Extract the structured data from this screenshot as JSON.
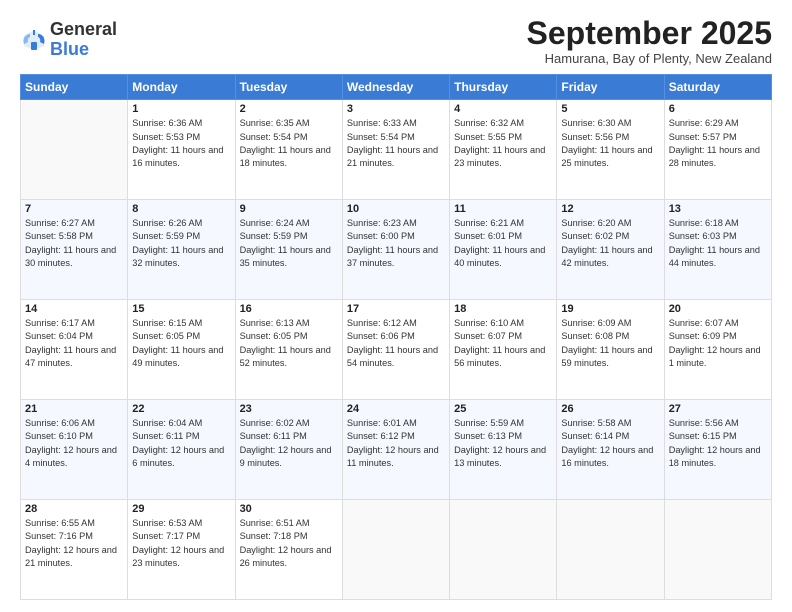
{
  "header": {
    "logo": {
      "general": "General",
      "blue": "Blue"
    },
    "title": "September 2025",
    "location": "Hamurana, Bay of Plenty, New Zealand"
  },
  "days": [
    "Sunday",
    "Monday",
    "Tuesday",
    "Wednesday",
    "Thursday",
    "Friday",
    "Saturday"
  ],
  "weeks": [
    [
      null,
      {
        "n": "1",
        "sr": "6:36 AM",
        "ss": "5:53 PM",
        "dl": "11 hours and 16 minutes."
      },
      {
        "n": "2",
        "sr": "6:35 AM",
        "ss": "5:54 PM",
        "dl": "11 hours and 18 minutes."
      },
      {
        "n": "3",
        "sr": "6:33 AM",
        "ss": "5:54 PM",
        "dl": "11 hours and 21 minutes."
      },
      {
        "n": "4",
        "sr": "6:32 AM",
        "ss": "5:55 PM",
        "dl": "11 hours and 23 minutes."
      },
      {
        "n": "5",
        "sr": "6:30 AM",
        "ss": "5:56 PM",
        "dl": "11 hours and 25 minutes."
      },
      {
        "n": "6",
        "sr": "6:29 AM",
        "ss": "5:57 PM",
        "dl": "11 hours and 28 minutes."
      }
    ],
    [
      {
        "n": "7",
        "sr": "6:27 AM",
        "ss": "5:58 PM",
        "dl": "11 hours and 30 minutes."
      },
      {
        "n": "8",
        "sr": "6:26 AM",
        "ss": "5:59 PM",
        "dl": "11 hours and 32 minutes."
      },
      {
        "n": "9",
        "sr": "6:24 AM",
        "ss": "5:59 PM",
        "dl": "11 hours and 35 minutes."
      },
      {
        "n": "10",
        "sr": "6:23 AM",
        "ss": "6:00 PM",
        "dl": "11 hours and 37 minutes."
      },
      {
        "n": "11",
        "sr": "6:21 AM",
        "ss": "6:01 PM",
        "dl": "11 hours and 40 minutes."
      },
      {
        "n": "12",
        "sr": "6:20 AM",
        "ss": "6:02 PM",
        "dl": "11 hours and 42 minutes."
      },
      {
        "n": "13",
        "sr": "6:18 AM",
        "ss": "6:03 PM",
        "dl": "11 hours and 44 minutes."
      }
    ],
    [
      {
        "n": "14",
        "sr": "6:17 AM",
        "ss": "6:04 PM",
        "dl": "11 hours and 47 minutes."
      },
      {
        "n": "15",
        "sr": "6:15 AM",
        "ss": "6:05 PM",
        "dl": "11 hours and 49 minutes."
      },
      {
        "n": "16",
        "sr": "6:13 AM",
        "ss": "6:05 PM",
        "dl": "11 hours and 52 minutes."
      },
      {
        "n": "17",
        "sr": "6:12 AM",
        "ss": "6:06 PM",
        "dl": "11 hours and 54 minutes."
      },
      {
        "n": "18",
        "sr": "6:10 AM",
        "ss": "6:07 PM",
        "dl": "11 hours and 56 minutes."
      },
      {
        "n": "19",
        "sr": "6:09 AM",
        "ss": "6:08 PM",
        "dl": "11 hours and 59 minutes."
      },
      {
        "n": "20",
        "sr": "6:07 AM",
        "ss": "6:09 PM",
        "dl": "12 hours and 1 minute."
      }
    ],
    [
      {
        "n": "21",
        "sr": "6:06 AM",
        "ss": "6:10 PM",
        "dl": "12 hours and 4 minutes."
      },
      {
        "n": "22",
        "sr": "6:04 AM",
        "ss": "6:11 PM",
        "dl": "12 hours and 6 minutes."
      },
      {
        "n": "23",
        "sr": "6:02 AM",
        "ss": "6:11 PM",
        "dl": "12 hours and 9 minutes."
      },
      {
        "n": "24",
        "sr": "6:01 AM",
        "ss": "6:12 PM",
        "dl": "12 hours and 11 minutes."
      },
      {
        "n": "25",
        "sr": "5:59 AM",
        "ss": "6:13 PM",
        "dl": "12 hours and 13 minutes."
      },
      {
        "n": "26",
        "sr": "5:58 AM",
        "ss": "6:14 PM",
        "dl": "12 hours and 16 minutes."
      },
      {
        "n": "27",
        "sr": "5:56 AM",
        "ss": "6:15 PM",
        "dl": "12 hours and 18 minutes."
      }
    ],
    [
      {
        "n": "28",
        "sr": "6:55 AM",
        "ss": "7:16 PM",
        "dl": "12 hours and 21 minutes."
      },
      {
        "n": "29",
        "sr": "6:53 AM",
        "ss": "7:17 PM",
        "dl": "12 hours and 23 minutes."
      },
      {
        "n": "30",
        "sr": "6:51 AM",
        "ss": "7:18 PM",
        "dl": "12 hours and 26 minutes."
      },
      null,
      null,
      null,
      null
    ]
  ]
}
